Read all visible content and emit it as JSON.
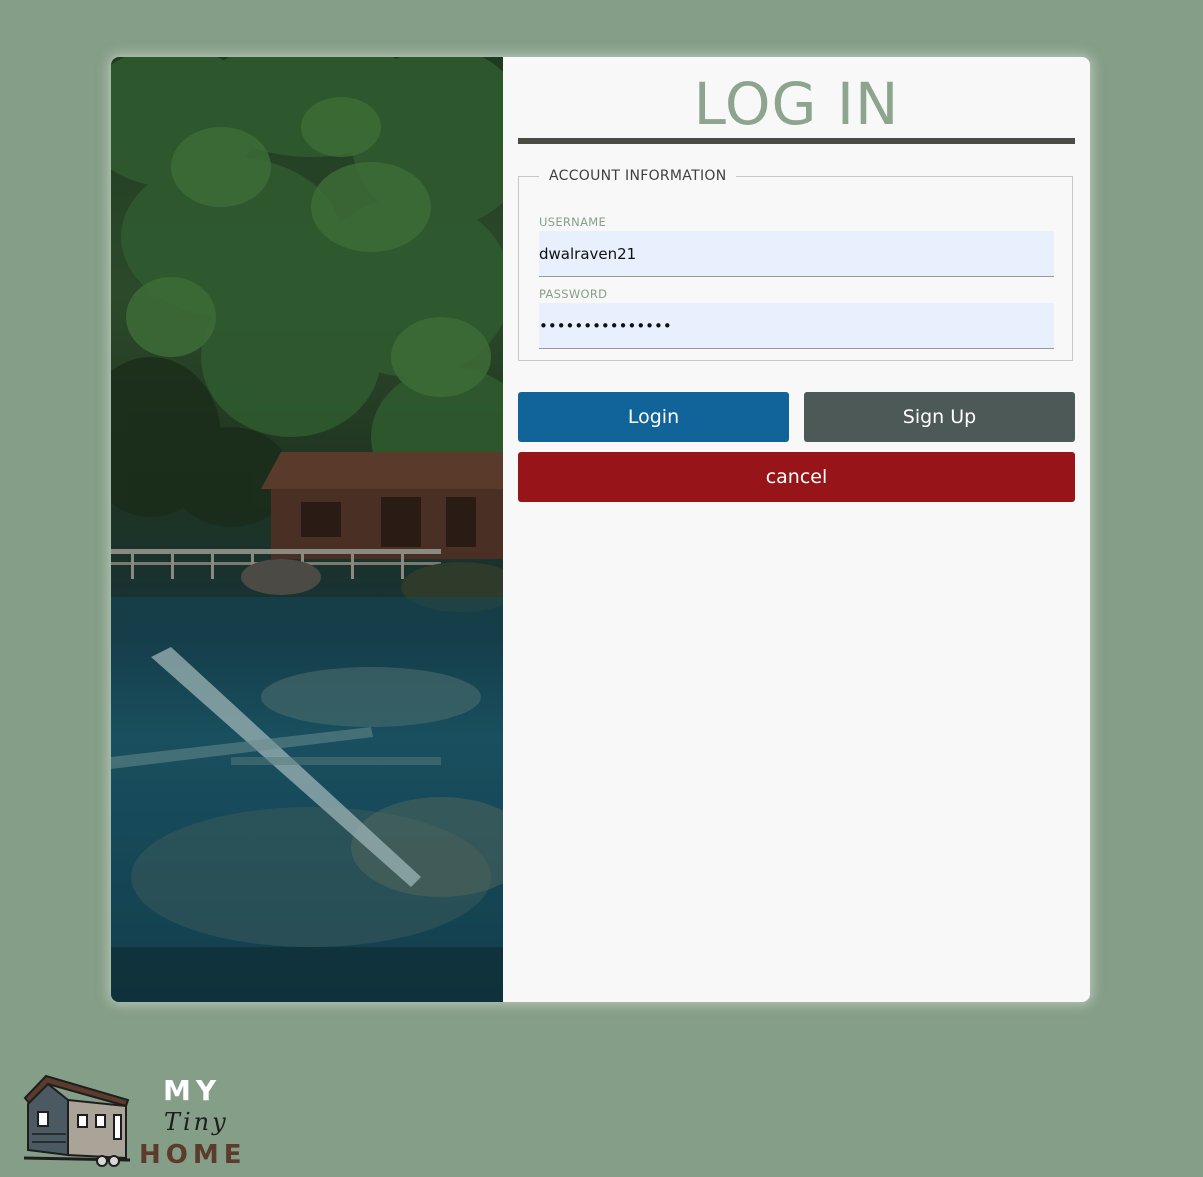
{
  "login": {
    "title": "LOG IN",
    "fieldset_legend": "ACCOUNT INFORMATION",
    "username": {
      "label": "USERNAME",
      "value": "dwalraven21"
    },
    "password": {
      "label": "PASSWORD",
      "value": "•••••••••••••••"
    },
    "buttons": {
      "login": "Login",
      "signup": "Sign Up",
      "cancel": "cancel"
    }
  },
  "logo": {
    "line1": "MY",
    "line2": "Tiny",
    "line3": "HOME"
  },
  "colors": {
    "background": "#859e87",
    "title": "#8da48f",
    "login_button": "#11649a",
    "signup_button": "#4d5957",
    "cancel_button": "#971418",
    "input_fill": "#e8f0fe"
  },
  "icons": {
    "logo_image": "tiny-house-icon",
    "side_photo": "forest-cabin-lake-photo"
  }
}
